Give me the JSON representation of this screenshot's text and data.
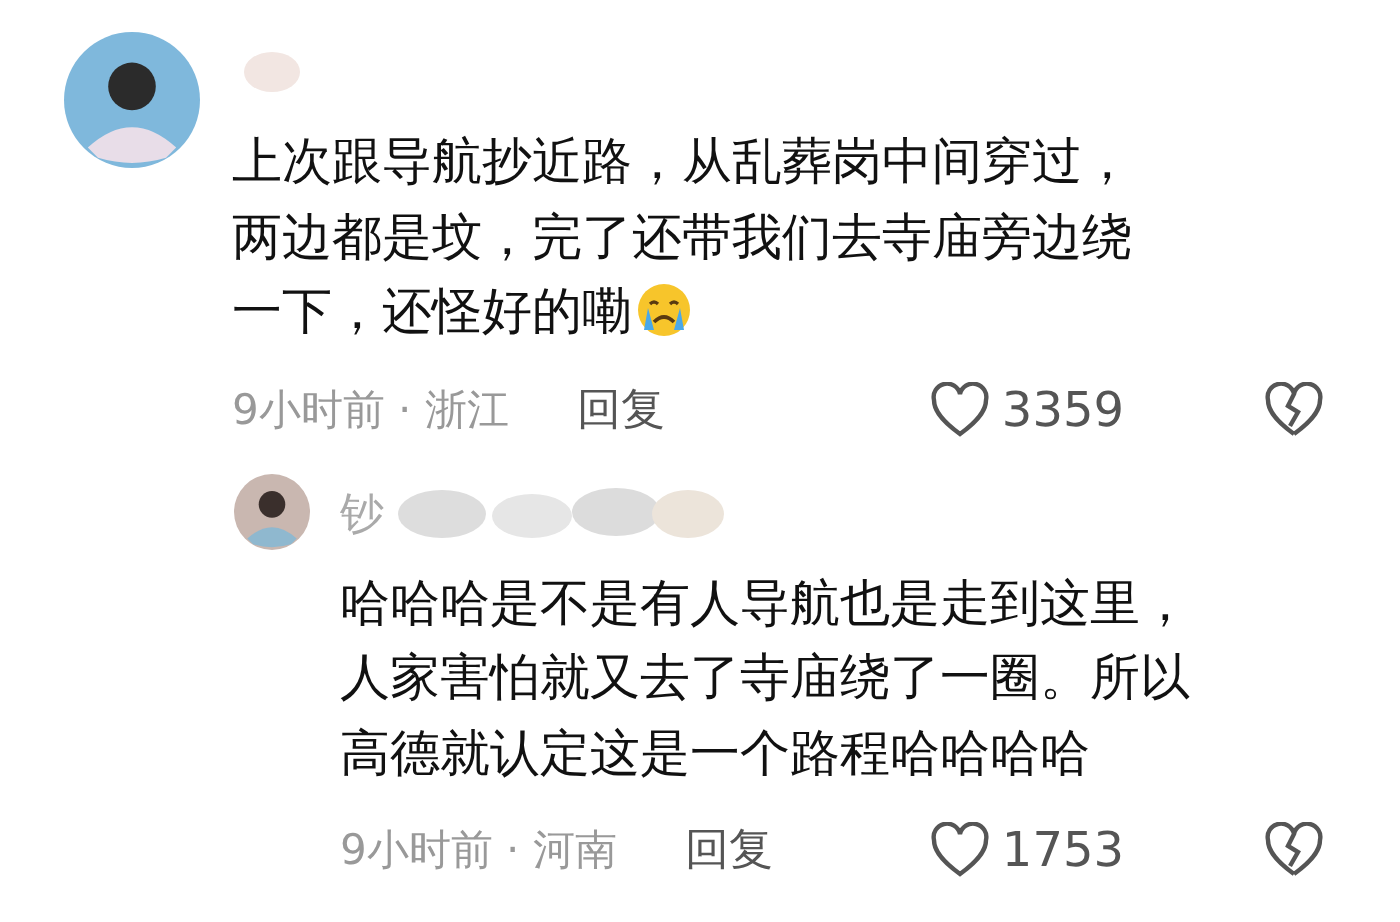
{
  "comments": [
    {
      "lines": [
        "上次跟导航抄近路，从乱葬岗中间穿过，",
        "两边都是坟，完了还带我们去寺庙旁边绕",
        "一下，还怪好的嘞"
      ],
      "crying_emoji": true,
      "meta": "9小时前 · 浙江",
      "reply": "回复",
      "likes": "3359",
      "kind": "top"
    },
    {
      "username": "钞",
      "lines": [
        "哈哈哈是不是有人导航也是走到这里，",
        "人家害怕就又去了寺庙绕了一圈。所以",
        "高德就认定这是一个路程哈哈哈哈"
      ],
      "crying_emoji": false,
      "meta": "9小时前 · 河南",
      "reply": "回复",
      "likes": "1753",
      "kind": "reply"
    }
  ]
}
